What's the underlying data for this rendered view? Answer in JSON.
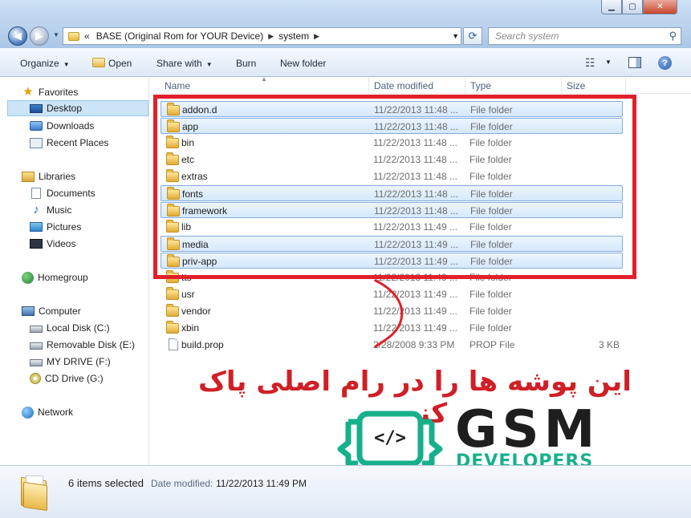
{
  "window": {
    "minimize": "▁",
    "maximize": "▢",
    "close": "✕"
  },
  "address": {
    "overflow": "«",
    "crumbs": [
      "BASE  (Original Rom for YOUR Device)",
      "system"
    ],
    "search_placeholder": "Search system"
  },
  "toolbar": {
    "organize": "Organize",
    "open": "Open",
    "share_with": "Share with",
    "burn": "Burn",
    "new_folder": "New folder"
  },
  "sidebar": {
    "favorites": {
      "label": "Favorites",
      "items": [
        "Desktop",
        "Downloads",
        "Recent Places"
      ]
    },
    "libraries": {
      "label": "Libraries",
      "items": [
        "Documents",
        "Music",
        "Pictures",
        "Videos"
      ]
    },
    "homegroup": "Homegroup",
    "computer": {
      "label": "Computer",
      "items": [
        "Local Disk (C:)",
        "Removable Disk (E:)",
        "MY DRIVE (F:)",
        "CD Drive (G:)"
      ]
    },
    "network": "Network"
  },
  "columns": {
    "name": "Name",
    "date": "Date modified",
    "type": "Type",
    "size": "Size"
  },
  "files": [
    {
      "name": "addon.d",
      "date": "11/22/2013 11:48 ...",
      "type": "File folder",
      "size": "",
      "selected": true
    },
    {
      "name": "app",
      "date": "11/22/2013 11:48 ...",
      "type": "File folder",
      "size": "",
      "selected": true
    },
    {
      "name": "bin",
      "date": "11/22/2013 11:48 ...",
      "type": "File folder",
      "size": "",
      "selected": false
    },
    {
      "name": "etc",
      "date": "11/22/2013 11:48 ...",
      "type": "File folder",
      "size": "",
      "selected": false
    },
    {
      "name": "extras",
      "date": "11/22/2013 11:48 ...",
      "type": "File folder",
      "size": "",
      "selected": false
    },
    {
      "name": "fonts",
      "date": "11/22/2013 11:48 ...",
      "type": "File folder",
      "size": "",
      "selected": true
    },
    {
      "name": "framework",
      "date": "11/22/2013 11:48 ...",
      "type": "File folder",
      "size": "",
      "selected": true
    },
    {
      "name": "lib",
      "date": "11/22/2013 11:49 ...",
      "type": "File folder",
      "size": "",
      "selected": false
    },
    {
      "name": "media",
      "date": "11/22/2013 11:49 ...",
      "type": "File folder",
      "size": "",
      "selected": true
    },
    {
      "name": "priv-app",
      "date": "11/22/2013 11:49 ...",
      "type": "File folder",
      "size": "",
      "selected": true
    },
    {
      "name": "tts",
      "date": "11/22/2013 11:49 ...",
      "type": "File folder",
      "size": "",
      "selected": false
    },
    {
      "name": "usr",
      "date": "11/22/2013 11:49 ...",
      "type": "File folder",
      "size": "",
      "selected": false
    },
    {
      "name": "vendor",
      "date": "11/22/2013 11:49 ...",
      "type": "File folder",
      "size": "",
      "selected": false
    },
    {
      "name": "xbin",
      "date": "11/22/2013 11:49 ...",
      "type": "File folder",
      "size": "",
      "selected": false
    },
    {
      "name": "build.prop",
      "date": "2/28/2008 9:33 PM",
      "type": "PROP File",
      "size": "3 KB",
      "selected": false,
      "is_file": true
    }
  ],
  "annotation": {
    "persian_text": "این پوشه ها را در رام اصلی پاک کنید.",
    "accent": "#e2202a"
  },
  "logo": {
    "code_symbol": "</>",
    "title": "GSM",
    "subtitle": "DEVELOPERS",
    "accent": "#16b08b"
  },
  "details": {
    "count": "6 items selected",
    "date_label": "Date modified:",
    "date_value": "11/22/2013 11:49 PM"
  }
}
